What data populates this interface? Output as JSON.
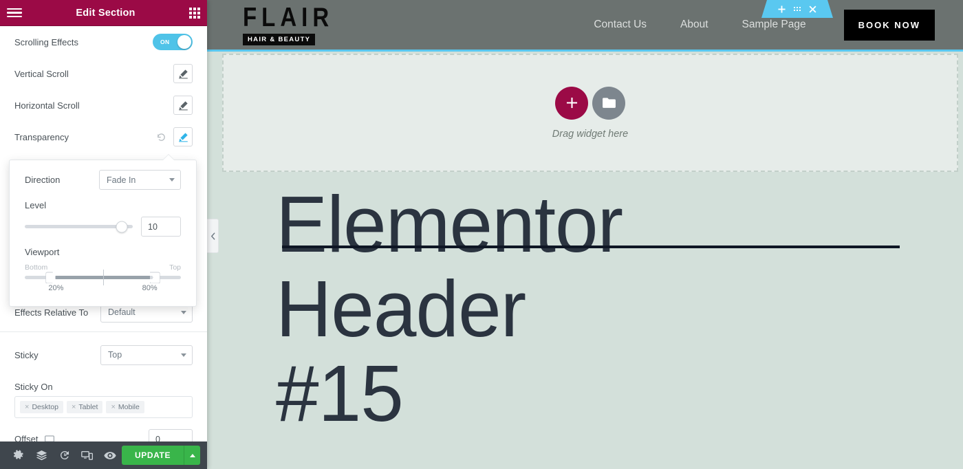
{
  "panel": {
    "header": {
      "title": "Edit Section",
      "menu_icon": "hamburger-icon",
      "widgets_icon": "widgets-grid-icon"
    },
    "controls": [
      {
        "label": "Scrolling Effects",
        "type": "switch",
        "value": "ON"
      },
      {
        "label": "Vertical Scroll",
        "type": "edit"
      },
      {
        "label": "Horizontal Scroll",
        "type": "edit"
      },
      {
        "label": "Transparency",
        "type": "edit",
        "has_reset": true,
        "active": true
      }
    ],
    "popover": {
      "direction_label": "Direction",
      "direction_value": "Fade In",
      "level_label": "Level",
      "level_value": "10",
      "level_percent": 90,
      "viewport_label": "Viewport",
      "viewport_start_label": "Bottom",
      "viewport_end_label": "Top",
      "viewport_min": "20%",
      "viewport_max": "80%",
      "viewport_min_percent": 20,
      "viewport_max_percent": 80
    },
    "effects_relative": {
      "label": "Effects Relative To",
      "value": "Default"
    },
    "sticky": {
      "label": "Sticky",
      "value": "Top"
    },
    "sticky_on": {
      "label": "Sticky On",
      "tags": [
        "Desktop",
        "Tablet",
        "Mobile"
      ]
    },
    "offset": {
      "label": "Offset",
      "value": "0",
      "device_icon": "desktop-icon"
    },
    "footer": {
      "icons": [
        "settings-gear-icon",
        "navigator-layers-icon",
        "history-icon",
        "responsive-mode-icon",
        "preview-eye-icon"
      ],
      "update_label": "UPDATE"
    }
  },
  "canvas": {
    "site_header": {
      "logo_main": "FLAIR",
      "logo_sub": "HAIR & BEAUTY",
      "nav": [
        "Contact Us",
        "About",
        "Sample Page"
      ],
      "cta": "BOOK NOW"
    },
    "section_toolbar": {
      "add_icon": "plus-icon",
      "drag_icon": "drag-handle-icon",
      "close_icon": "close-icon"
    },
    "dropzone": {
      "add_icon": "plus-icon",
      "template_icon": "folder-icon",
      "text": "Drag widget here"
    },
    "collapse_icon": "chevron-left-icon",
    "hero_title": "Elementor Header\n#15"
  },
  "colors": {
    "panel_header": "#9b0a46",
    "accent_cyan": "#5ac8f0",
    "update_green": "#39b54a",
    "canvas_bg": "#d3e0da",
    "site_header_bg": "#6b7270"
  }
}
